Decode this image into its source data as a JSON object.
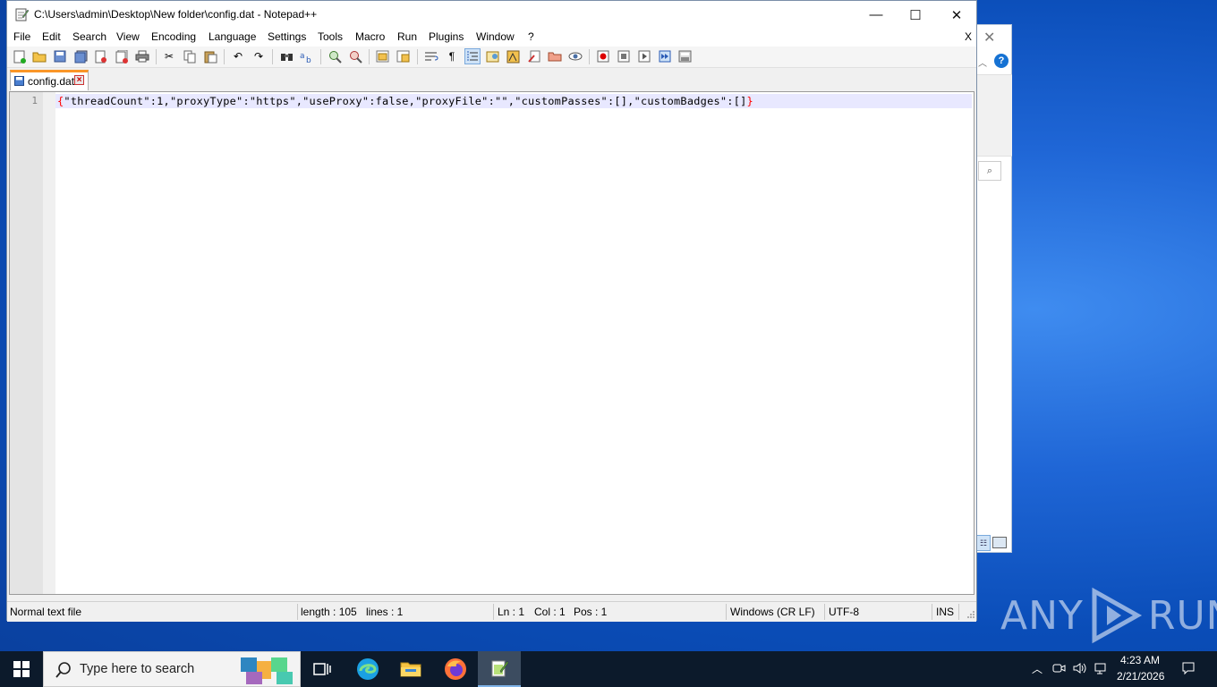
{
  "window": {
    "title": "C:\\Users\\admin\\Desktop\\New folder\\config.dat - Notepad++",
    "min_label": "—",
    "max_label": "☐",
    "close_label": "✕"
  },
  "menu": {
    "items": [
      "File",
      "Edit",
      "Search",
      "View",
      "Encoding",
      "Language",
      "Settings",
      "Tools",
      "Macro",
      "Run",
      "Plugins",
      "Window",
      "?"
    ],
    "close_doc": "X"
  },
  "toolbar": {
    "icons": [
      "new-file-icon",
      "open-file-icon",
      "save-icon",
      "save-all-icon",
      "close-icon",
      "close-all-icon",
      "print-icon",
      "cut-icon",
      "copy-icon",
      "paste-icon",
      "undo-icon",
      "redo-icon",
      "find-icon",
      "replace-icon",
      "zoom-in-icon",
      "zoom-out-icon",
      "sync-vertical-icon",
      "sync-horizontal-icon",
      "word-wrap-icon",
      "show-all-chars-icon",
      "indent-guide-icon",
      "user-language-icon",
      "doc-map-icon",
      "function-list-icon",
      "folder-workspace-icon",
      "monitoring-icon",
      "record-macro-icon",
      "stop-macro-icon",
      "play-macro-icon",
      "run-macro-multiple-icon",
      "save-macro-icon"
    ]
  },
  "tab": {
    "label": "config.dat",
    "close_label": "×"
  },
  "editor": {
    "line_number": "1",
    "open_brace": "{",
    "body": "\"threadCount\":1,\"proxyType\":\"https\",\"useProxy\":false,\"proxyFile\":\"\",\"customPasses\":[],\"customBadges\":[]",
    "close_brace": "}"
  },
  "status": {
    "file_type": "Normal text file",
    "length": "length : 105",
    "lines": "lines : 1",
    "ln": "Ln : 1",
    "col": "Col : 1",
    "pos": "Pos : 1",
    "eol": "Windows (CR LF)",
    "encoding": "UTF-8",
    "mode": "INS"
  },
  "background_window": {
    "close_label": "✕",
    "help_label": "?"
  },
  "watermark": {
    "left": "ANY",
    "right": "RUN"
  },
  "taskbar": {
    "search_placeholder": "Type here to search",
    "apps": [
      "task-view-icon",
      "edge-icon",
      "file-explorer-icon",
      "firefox-icon",
      "notepadpp-icon"
    ],
    "time": "4:23 AM",
    "date": "2/21/2026"
  },
  "colors": {
    "tab_accent": "#fa9628",
    "current_line": "#e8e8ff",
    "brace": "#ff0000",
    "taskbar": "#0c1a2b",
    "desktop": "#1f66d6"
  }
}
